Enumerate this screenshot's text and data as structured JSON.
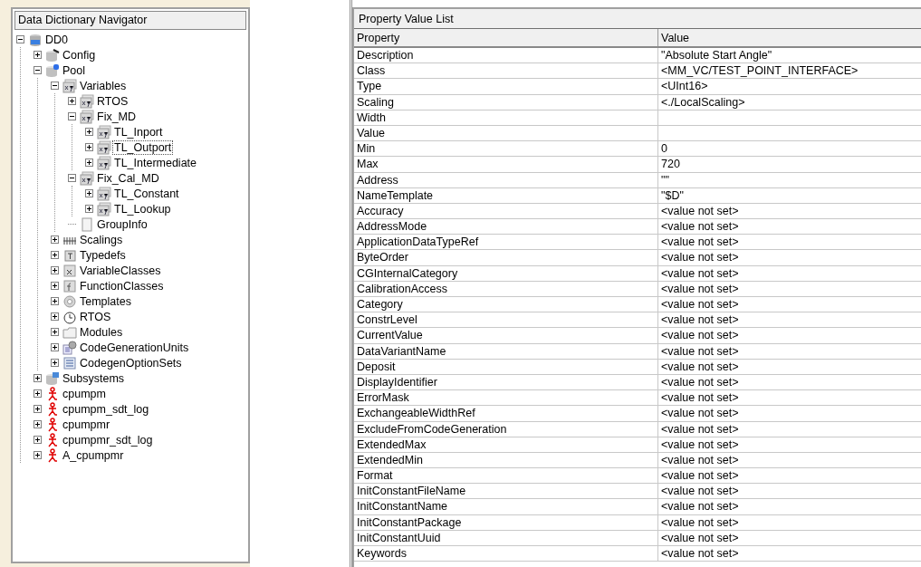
{
  "navigator": {
    "title": "Data Dictionary Navigator",
    "tree": [
      {
        "label": "DD0",
        "kind": "dd",
        "expanded": true,
        "selected": false,
        "children": [
          {
            "label": "Config",
            "kind": "config",
            "expanded": false,
            "selected": false
          },
          {
            "label": "Pool",
            "kind": "pool",
            "expanded": true,
            "selected": false,
            "children": [
              {
                "label": "Variables",
                "kind": "xy",
                "expanded": true,
                "selected": false,
                "children": [
                  {
                    "label": "RTOS",
                    "kind": "xy",
                    "expanded": false,
                    "selected": false
                  },
                  {
                    "label": "Fix_MD",
                    "kind": "xy",
                    "expanded": true,
                    "selected": false,
                    "children": [
                      {
                        "label": "TL_Inport",
                        "kind": "xy",
                        "expanded": false,
                        "selected": false
                      },
                      {
                        "label": "TL_Outport",
                        "kind": "xy",
                        "expanded": false,
                        "selected": true
                      },
                      {
                        "label": "TL_Intermediate",
                        "kind": "xy",
                        "expanded": false,
                        "selected": false
                      }
                    ]
                  },
                  {
                    "label": "Fix_Cal_MD",
                    "kind": "xy",
                    "expanded": true,
                    "selected": false,
                    "children": [
                      {
                        "label": "TL_Constant",
                        "kind": "xy",
                        "expanded": false,
                        "selected": false
                      },
                      {
                        "label": "TL_Lookup",
                        "kind": "xy",
                        "expanded": false,
                        "selected": false
                      }
                    ]
                  },
                  {
                    "label": "GroupInfo",
                    "kind": "file",
                    "selected": false
                  }
                ]
              },
              {
                "label": "Scalings",
                "kind": "scaling",
                "expanded": false,
                "selected": false
              },
              {
                "label": "Typedefs",
                "kind": "typedef",
                "expanded": false,
                "selected": false
              },
              {
                "label": "VariableClasses",
                "kind": "varclass",
                "expanded": false,
                "selected": false
              },
              {
                "label": "FunctionClasses",
                "kind": "funcclass",
                "expanded": false,
                "selected": false
              },
              {
                "label": "Templates",
                "kind": "template",
                "expanded": false,
                "selected": false
              },
              {
                "label": "RTOS",
                "kind": "rtos",
                "expanded": false,
                "selected": false
              },
              {
                "label": "Modules",
                "kind": "module",
                "expanded": false,
                "selected": false
              },
              {
                "label": "CodeGenerationUnits",
                "kind": "cgu",
                "expanded": false,
                "selected": false
              },
              {
                "label": "CodegenOptionSets",
                "kind": "optionset",
                "expanded": false,
                "selected": false
              }
            ]
          },
          {
            "label": "Subsystems",
            "kind": "subsystem",
            "expanded": false,
            "selected": false
          },
          {
            "label": "cpumpm",
            "kind": "person",
            "expanded": false,
            "selected": false
          },
          {
            "label": "cpumpm_sdt_log",
            "kind": "person",
            "expanded": false,
            "selected": false
          },
          {
            "label": "cpumpmr",
            "kind": "person",
            "expanded": false,
            "selected": false
          },
          {
            "label": "cpumpmr_sdt_log",
            "kind": "person",
            "expanded": false,
            "selected": false
          },
          {
            "label": "A_cpumpmr",
            "kind": "person",
            "expanded": false,
            "selected": false
          }
        ]
      }
    ]
  },
  "property_list": {
    "title": "Property Value List",
    "columns": [
      "Property",
      "Value"
    ],
    "rows": [
      [
        "Description",
        "\"Absolute Start Angle\""
      ],
      [
        "Class",
        "<MM_VC/TEST_POINT_INTERFACE>"
      ],
      [
        "Type",
        "<UInt16>"
      ],
      [
        "Scaling",
        "<./LocalScaling>"
      ],
      [
        "Width",
        ""
      ],
      [
        "Value",
        ""
      ],
      [
        "Min",
        "0"
      ],
      [
        "Max",
        "720"
      ],
      [
        "Address",
        "\"\""
      ],
      [
        "NameTemplate",
        "\"$D\""
      ],
      [
        "Accuracy",
        "<value not set>"
      ],
      [
        "AddressMode",
        "<value not set>"
      ],
      [
        "ApplicationDataTypeRef",
        "<value not set>"
      ],
      [
        "ByteOrder",
        "<value not set>"
      ],
      [
        "CGInternalCategory",
        "<value not set>"
      ],
      [
        "CalibrationAccess",
        "<value not set>"
      ],
      [
        "Category",
        "<value not set>"
      ],
      [
        "ConstrLevel",
        "<value not set>"
      ],
      [
        "CurrentValue",
        "<value not set>"
      ],
      [
        "DataVariantName",
        "<value not set>"
      ],
      [
        "Deposit",
        "<value not set>"
      ],
      [
        "DisplayIdentifier",
        "<value not set>"
      ],
      [
        "ErrorMask",
        "<value not set>"
      ],
      [
        "ExchangeableWidthRef",
        "<value not set>"
      ],
      [
        "ExcludeFromCodeGeneration",
        "<value not set>"
      ],
      [
        "ExtendedMax",
        "<value not set>"
      ],
      [
        "ExtendedMin",
        "<value not set>"
      ],
      [
        "Format",
        "<value not set>"
      ],
      [
        "InitConstantFileName",
        "<value not set>"
      ],
      [
        "InitConstantName",
        "<value not set>"
      ],
      [
        "InitConstantPackage",
        "<value not set>"
      ],
      [
        "InitConstantUuid",
        "<value not set>"
      ],
      [
        "Keywords",
        "<value not set>"
      ]
    ]
  }
}
